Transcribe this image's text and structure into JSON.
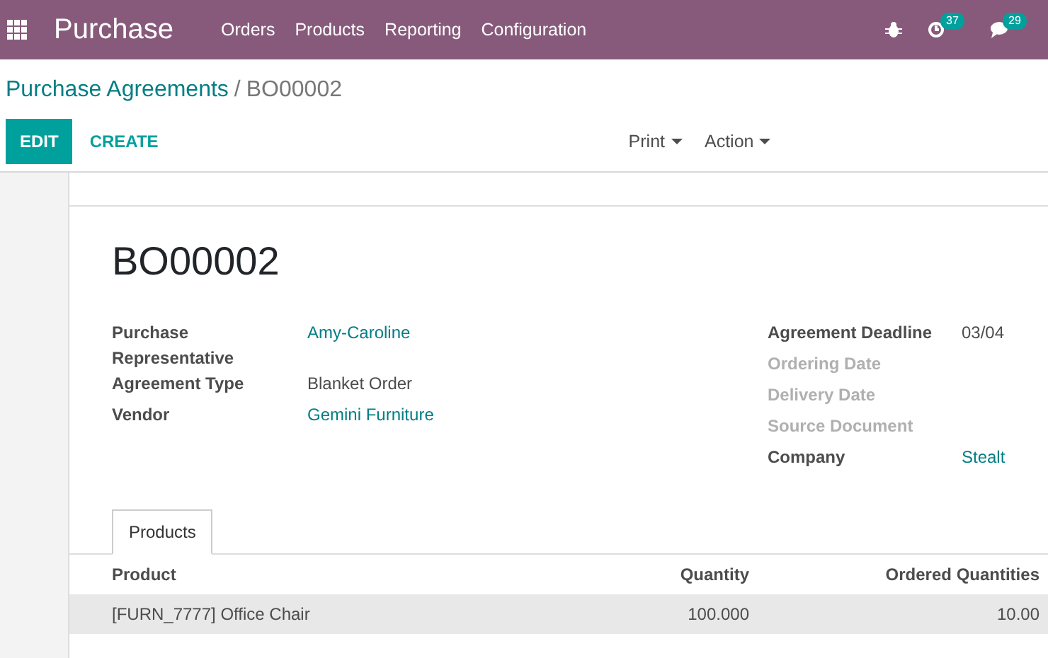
{
  "navbar": {
    "app_name": "Purchase",
    "menu": [
      "Orders",
      "Products",
      "Reporting",
      "Configuration"
    ],
    "activity_badge": "37",
    "messages_badge": "29"
  },
  "breadcrumb": {
    "parent": "Purchase Agreements",
    "separator": "/",
    "current": "BO00002"
  },
  "buttons": {
    "primary": "EDIT",
    "secondary": "CREATE",
    "dropdowns": [
      "Print",
      "Action"
    ]
  },
  "record": {
    "title": "BO00002",
    "left_fields": [
      {
        "label": "Purchase Representative",
        "value": "Amy-Caroline",
        "kind": "link"
      },
      {
        "label": "Agreement Type",
        "value": "Blanket Order",
        "kind": "plain"
      },
      {
        "label": "Vendor",
        "value": "Gemini Furniture",
        "kind": "link"
      }
    ],
    "right_fields": [
      {
        "label": "Agreement Deadline",
        "value": "03/04",
        "kind": "plain",
        "empty": false
      },
      {
        "label": "Ordering Date",
        "empty": true
      },
      {
        "label": "Delivery Date",
        "empty": true
      },
      {
        "label": "Source Document",
        "empty": true
      },
      {
        "label": "Company",
        "value": "Stealt",
        "kind": "link",
        "empty": false
      }
    ]
  },
  "tabs": [
    {
      "label": "Products",
      "selected": true
    }
  ],
  "table": {
    "columns": [
      "Product",
      "Quantity",
      "Ordered Quantities"
    ],
    "rows": [
      {
        "cells": [
          "[FURN_7777] Office Chair",
          "100.000",
          "10.00"
        ],
        "hovered": true
      }
    ]
  }
}
